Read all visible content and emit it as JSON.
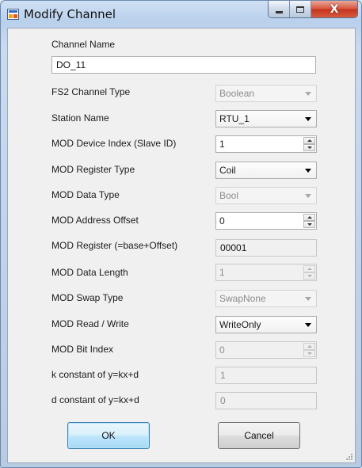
{
  "window": {
    "title": "Modify Channel",
    "close_glyph": "X",
    "icon": "app-window-icon"
  },
  "form": {
    "channel_name": {
      "label": "Channel Name",
      "value": "DO_11"
    },
    "fs2_channel_type": {
      "label": "FS2 Channel Type",
      "value": "Boolean"
    },
    "station_name": {
      "label": "Station Name",
      "value": "RTU_1"
    },
    "mod_device_index": {
      "label": "MOD Device Index (Slave ID)",
      "value": "1"
    },
    "mod_register_type": {
      "label": "MOD Register Type",
      "value": "Coil"
    },
    "mod_data_type": {
      "label": "MOD Data Type",
      "value": "Bool"
    },
    "mod_address_offset": {
      "label": "MOD Address Offset",
      "value": "0"
    },
    "mod_register": {
      "label": "MOD Register (=base+Offset)",
      "value": "00001"
    },
    "mod_data_length": {
      "label": "MOD Data Length",
      "value": "1"
    },
    "mod_swap_type": {
      "label": "MOD Swap Type",
      "value": "SwapNone"
    },
    "mod_read_write": {
      "label": "MOD Read / Write",
      "value": "WriteOnly"
    },
    "mod_bit_index": {
      "label": "MOD Bit Index",
      "value": "0"
    },
    "k_constant": {
      "label": "k constant of y=kx+d",
      "value": "1"
    },
    "d_constant": {
      "label": "d constant of y=kx+d",
      "value": "0"
    }
  },
  "buttons": {
    "ok": "OK",
    "cancel": "Cancel"
  }
}
